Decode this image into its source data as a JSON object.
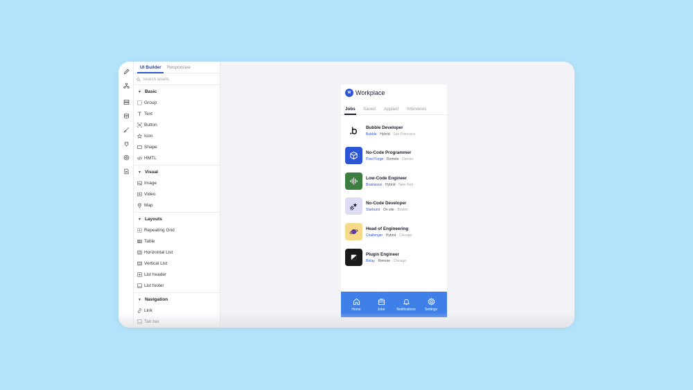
{
  "builder": {
    "tabs": [
      {
        "label": "UI Builder"
      },
      {
        "label": "Responsive"
      }
    ],
    "search_placeholder": "Search assets",
    "sections": [
      {
        "title": "Basic",
        "items": [
          {
            "label": "Group",
            "icon": "group-icon"
          },
          {
            "label": "Text",
            "icon": "text-icon"
          },
          {
            "label": "Button",
            "icon": "button-icon"
          },
          {
            "label": "Icon",
            "icon": "star-icon"
          },
          {
            "label": "Shape",
            "icon": "shape-icon"
          },
          {
            "label": "HMTL",
            "icon": "code-icon"
          }
        ]
      },
      {
        "title": "Visual",
        "items": [
          {
            "label": "Image",
            "icon": "image-icon"
          },
          {
            "label": "Video",
            "icon": "video-icon"
          },
          {
            "label": "Map",
            "icon": "map-pin-icon"
          }
        ]
      },
      {
        "title": "Layouts",
        "items": [
          {
            "label": "Repeating Grid",
            "icon": "repeating-grid-icon"
          },
          {
            "label": "Table",
            "icon": "table-icon"
          },
          {
            "label": "Horizontal List",
            "icon": "horizontal-list-icon"
          },
          {
            "label": "Vertical List",
            "icon": "vertical-list-icon"
          },
          {
            "label": "List header",
            "icon": "list-header-icon"
          },
          {
            "label": "List footer",
            "icon": "list-footer-icon"
          }
        ]
      },
      {
        "title": "Navigation",
        "items": [
          {
            "label": "Link",
            "icon": "link-icon"
          },
          {
            "label": "Tab bar",
            "icon": "tab-bar-icon"
          }
        ]
      }
    ]
  },
  "app": {
    "title": "Workplace",
    "logo_text": "W",
    "tabs": [
      {
        "label": "Jobs"
      },
      {
        "label": "Saved"
      },
      {
        "label": "Applied"
      },
      {
        "label": "Interviews"
      }
    ],
    "jobs": [
      {
        "title": "Bubble Developer",
        "company": "Bubble",
        "mode": "Hybrid",
        "location": "San Francisco",
        "logo_color": "#ffffff",
        "logo_icon": "bubble-logo-icon"
      },
      {
        "title": "No-Code Programmer",
        "company": "Pixel Forge",
        "mode": "Remote",
        "location": "Denver",
        "logo_color": "#2c55d6",
        "logo_icon": "cube-icon"
      },
      {
        "title": "Low-Code Engineer",
        "company": "Brainwave",
        "mode": "Hybrid",
        "location": "New York",
        "logo_color": "#3d7d3f",
        "logo_icon": "waveform-icon"
      },
      {
        "title": "No-Code Developer",
        "company": "Starburst",
        "mode": "On site",
        "location": "Boston",
        "logo_color": "#dcdcf3",
        "logo_icon": "shooting-star-icon"
      },
      {
        "title": "Head of Engineering",
        "company": "Challenger",
        "mode": "Hybrid",
        "location": "Chicago",
        "logo_color": "#f7d98c",
        "logo_icon": "planet-icon"
      },
      {
        "title": "Plugin Engineer",
        "company": "Relay",
        "mode": "Remote",
        "location": "Chicago",
        "logo_color": "#1a1a1a",
        "logo_icon": "relay-icon"
      }
    ],
    "nav": [
      {
        "label": "Home",
        "icon": "home-icon"
      },
      {
        "label": "Jobs",
        "icon": "briefcase-icon"
      },
      {
        "label": "Notifications",
        "icon": "bell-icon"
      },
      {
        "label": "Settings",
        "icon": "gear-icon"
      }
    ],
    "accent_color": "#3f7fe8"
  }
}
